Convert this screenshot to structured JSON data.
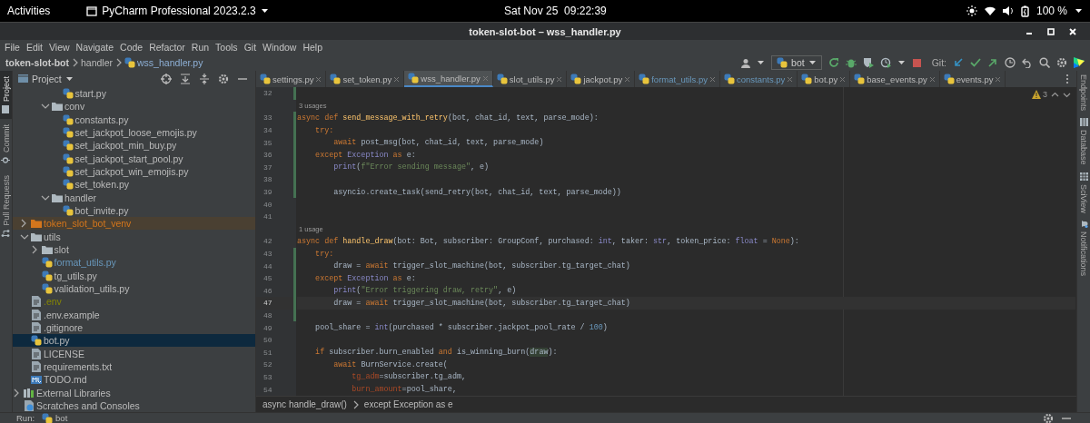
{
  "top_bar": {
    "activities": "Activities",
    "app_menu": "PyCharm Professional 2023.2.3",
    "clock": "Sat Nov 25  09:22:39",
    "battery": "100 %"
  },
  "window": {
    "title": "token-slot-bot – wss_handler.py"
  },
  "menu": [
    "File",
    "Edit",
    "View",
    "Navigate",
    "Code",
    "Refactor",
    "Run",
    "Tools",
    "Git",
    "Window",
    "Help"
  ],
  "breadcrumb": [
    {
      "label": "token-slot-bot",
      "kind": "project"
    },
    {
      "label": "handler",
      "kind": "folder"
    },
    {
      "label": "wss_handler.py",
      "kind": "file"
    }
  ],
  "toolbar": {
    "run_config": "bot",
    "git_label": "Git:"
  },
  "left_strip": [
    {
      "label": "Project",
      "selected": true
    },
    {
      "label": "Commit",
      "selected": false
    },
    {
      "label": "Pull Requests",
      "selected": false
    }
  ],
  "project_panel": {
    "title": "Project",
    "tree": [
      {
        "children": [
          {
            "children": [
              {
                "children": [
                  {
                    "children": [
                      {
                        "label": "start.py",
                        "kind": "python",
                        "selected": false
                      }
                    ]
                  },
                  {
                    "label": "conv",
                    "kind": "folder",
                    "expanded": true,
                    "selected": false,
                    "excluded": false,
                    "children": [
                      {
                        "label": "constants.py",
                        "kind": "python",
                        "selected": false
                      },
                      {
                        "label": "set_jackpot_loose_emojis.py",
                        "kind": "python",
                        "selected": false
                      },
                      {
                        "label": "set_jackpot_min_buy.py",
                        "kind": "python",
                        "selected": false
                      },
                      {
                        "label": "set_jackpot_start_pool.py",
                        "kind": "python",
                        "selected": false
                      },
                      {
                        "label": "set_jackpot_win_emojis.py",
                        "kind": "python",
                        "selected": false
                      },
                      {
                        "label": "set_token.py",
                        "kind": "python",
                        "selected": false
                      }
                    ]
                  },
                  {
                    "label": "handler",
                    "kind": "folder",
                    "expanded": true,
                    "selected": false,
                    "excluded": false,
                    "children": [
                      {
                        "label": "bot_invite.py",
                        "kind": "python",
                        "selected": false
                      }
                    ]
                  }
                ]
              }
            ]
          },
          {
            "label": "token_slot_bot_venv",
            "kind": "folder",
            "expanded": false,
            "selected": false,
            "excluded": true,
            "color": "#d4761c"
          },
          {
            "label": "utils",
            "kind": "folder",
            "expanded": true,
            "selected": false,
            "excluded": false,
            "children": [
              {
                "label": "slot",
                "kind": "folder",
                "expanded": false,
                "selected": false,
                "excluded": false
              },
              {
                "label": "format_utils.py",
                "kind": "python",
                "selected": false,
                "color": "#6897bb"
              },
              {
                "label": "tg_utils.py",
                "kind": "python",
                "selected": false
              },
              {
                "label": "validation_utils.py",
                "kind": "python",
                "selected": false
              }
            ]
          },
          {
            "label": ".env",
            "kind": "text",
            "selected": false,
            "color": "#848504"
          },
          {
            "label": ".env.example",
            "kind": "text",
            "selected": false
          },
          {
            "label": ".gitignore",
            "kind": "text",
            "selected": false
          },
          {
            "label": "bot.py",
            "kind": "python",
            "selected": true
          },
          {
            "label": "LICENSE",
            "kind": "text",
            "selected": false
          },
          {
            "label": "requirements.txt",
            "kind": "text",
            "selected": false
          },
          {
            "label": "TODO.md",
            "kind": "markdown",
            "selected": false
          }
        ]
      },
      {
        "label": "External Libraries",
        "kind": "library",
        "expanded": false,
        "selected": false
      },
      {
        "label": "Scratches and Consoles",
        "kind": "scratches",
        "selected": false
      }
    ]
  },
  "editor_tabs": [
    {
      "label": "settings.py",
      "selected": false,
      "modified": false
    },
    {
      "label": "set_token.py",
      "selected": false,
      "modified": false
    },
    {
      "label": "wss_handler.py",
      "selected": true,
      "modified": false
    },
    {
      "label": "slot_utils.py",
      "selected": false,
      "modified": false
    },
    {
      "label": "jackpot.py",
      "selected": false,
      "modified": false
    },
    {
      "label": "format_utils.py",
      "selected": false,
      "modified": true
    },
    {
      "label": "constants.py",
      "selected": false,
      "modified": true
    },
    {
      "label": "bot.py",
      "selected": false,
      "modified": false
    },
    {
      "label": "base_events.py",
      "selected": false,
      "modified": false
    },
    {
      "label": "events.py",
      "selected": false,
      "modified": false
    }
  ],
  "editor": {
    "warnings": "3",
    "lines": [
      {
        "kind": "code",
        "number": "32",
        "current": false,
        "changed": true
      },
      {
        "kind": "hint",
        "text": "3 usages"
      },
      {
        "kind": "code",
        "number": "33",
        "current": false,
        "changed": true,
        "tokens": [
          {
            "kind": "kw",
            "text": "async def "
          },
          {
            "kind": "fn",
            "text": "send_message_with_retry"
          },
          {
            "kind": "plain",
            "text": "(bot, chat_id, text, parse_mode):"
          }
        ]
      },
      {
        "kind": "code",
        "number": "34",
        "current": false,
        "changed": true,
        "tokens": [
          {
            "kind": "kw",
            "text": "    try:"
          }
        ]
      },
      {
        "kind": "code",
        "number": "35",
        "current": false,
        "changed": true,
        "tokens": [
          {
            "kind": "kw",
            "text": "        await "
          },
          {
            "kind": "plain",
            "text": "post_msg(bot, chat_id, text, parse_mode)"
          }
        ]
      },
      {
        "kind": "code",
        "number": "36",
        "current": false,
        "changed": true,
        "tokens": [
          {
            "kind": "kw",
            "text": "    except "
          },
          {
            "kind": "builtin",
            "text": "Exception"
          },
          {
            "kind": "kw",
            "text": " as "
          },
          {
            "kind": "plain",
            "text": "e:"
          }
        ]
      },
      {
        "kind": "code",
        "number": "37",
        "current": false,
        "changed": true,
        "tokens": [
          {
            "kind": "builtin",
            "text": "        print"
          },
          {
            "kind": "plain",
            "text": "("
          },
          {
            "kind": "str",
            "text": "f\"Error sending message\""
          },
          {
            "kind": "plain",
            "text": ", e)"
          }
        ]
      },
      {
        "kind": "code",
        "number": "38",
        "current": false,
        "changed": true
      },
      {
        "kind": "code",
        "number": "39",
        "current": false,
        "changed": true,
        "tokens": [
          {
            "kind": "plain",
            "text": "        asyncio.create_task(send_retry(bot, chat_id, text, parse_mode))"
          }
        ]
      },
      {
        "kind": "code",
        "number": "40",
        "current": false,
        "changed": false
      },
      {
        "kind": "code",
        "number": "41",
        "current": false,
        "changed": false
      },
      {
        "kind": "hint",
        "text": "1 usage"
      },
      {
        "kind": "code",
        "number": "42",
        "current": false,
        "changed": false,
        "tokens": [
          {
            "kind": "kw",
            "text": "async def "
          },
          {
            "kind": "fn",
            "text": "handle_draw"
          },
          {
            "kind": "plain",
            "text": "(bot: Bot, subscriber: GroupConf, purchased: "
          },
          {
            "kind": "builtin",
            "text": "int"
          },
          {
            "kind": "plain",
            "text": ", taker: "
          },
          {
            "kind": "builtin",
            "text": "str"
          },
          {
            "kind": "plain",
            "text": ", token_price: "
          },
          {
            "kind": "builtin",
            "text": "float"
          },
          {
            "kind": "plain",
            "text": " = "
          },
          {
            "kind": "kw",
            "text": "None"
          },
          {
            "kind": "plain",
            "text": "):"
          }
        ]
      },
      {
        "kind": "code",
        "number": "43",
        "current": false,
        "changed": true,
        "tokens": [
          {
            "kind": "kw",
            "text": "    try:"
          }
        ]
      },
      {
        "kind": "code",
        "number": "44",
        "current": false,
        "changed": true,
        "tokens": [
          {
            "kind": "plain",
            "text": "        draw = "
          },
          {
            "kind": "kw",
            "text": "await "
          },
          {
            "kind": "plain",
            "text": "trigger_slot_machine(bot, subscriber.tg_target_chat)"
          }
        ]
      },
      {
        "kind": "code",
        "number": "45",
        "current": false,
        "changed": true,
        "tokens": [
          {
            "kind": "kw",
            "text": "    except "
          },
          {
            "kind": "builtin",
            "text": "Exception"
          },
          {
            "kind": "kw",
            "text": " as "
          },
          {
            "kind": "plain",
            "text": "e:"
          }
        ]
      },
      {
        "kind": "code",
        "number": "46",
        "current": false,
        "changed": true,
        "tokens": [
          {
            "kind": "builtin",
            "text": "        print"
          },
          {
            "kind": "plain",
            "text": "("
          },
          {
            "kind": "str",
            "text": "\"Error triggering draw, retry\""
          },
          {
            "kind": "plain",
            "text": ", e)"
          }
        ]
      },
      {
        "kind": "code",
        "number": "47",
        "current": true,
        "changed": true,
        "tokens": [
          {
            "kind": "plain",
            "text": "        draw = "
          },
          {
            "kind": "kw",
            "text": "await "
          },
          {
            "kind": "plain",
            "text": "trigger_slot_machine(bot, subscriber.tg_target_chat)"
          }
        ]
      },
      {
        "kind": "code",
        "number": "48",
        "current": false,
        "changed": true
      },
      {
        "kind": "code",
        "number": "49",
        "current": false,
        "changed": false,
        "tokens": [
          {
            "kind": "plain",
            "text": "    pool_share = "
          },
          {
            "kind": "builtin",
            "text": "int"
          },
          {
            "kind": "plain",
            "text": "(purchased * subscriber.jackpot_pool_rate / "
          },
          {
            "kind": "num",
            "text": "100"
          },
          {
            "kind": "plain",
            "text": ")"
          }
        ]
      },
      {
        "kind": "code",
        "number": "50",
        "current": false,
        "changed": false
      },
      {
        "kind": "code",
        "number": "51",
        "current": false,
        "changed": false,
        "tokens": [
          {
            "kind": "kw",
            "text": "    if "
          },
          {
            "kind": "plain",
            "text": "subscriber.burn_enabled "
          },
          {
            "kind": "kw",
            "text": "and "
          },
          {
            "kind": "plain",
            "text": "is_winning_burn("
          },
          {
            "kind": "ref",
            "text": "draw"
          },
          {
            "kind": "plain",
            "text": "):"
          }
        ]
      },
      {
        "kind": "code",
        "number": "52",
        "current": false,
        "changed": false,
        "tokens": [
          {
            "kind": "kw",
            "text": "        await "
          },
          {
            "kind": "plain",
            "text": "BurnService.create("
          }
        ]
      },
      {
        "kind": "code",
        "number": "53",
        "current": false,
        "changed": false,
        "tokens": [
          {
            "kind": "param",
            "text": "            tg_adm"
          },
          {
            "kind": "plain",
            "text": "=subscriber.tg_adm,"
          }
        ]
      },
      {
        "kind": "code",
        "number": "54",
        "current": false,
        "changed": false,
        "tokens": [
          {
            "kind": "param",
            "text": "            burn_amount"
          },
          {
            "kind": "plain",
            "text": "=pool_share,"
          }
        ]
      }
    ],
    "breadcrumb": [
      "async handle_draw()",
      "except Exception as e"
    ]
  },
  "right_strip": [
    "Endpoints",
    "Database",
    "SciView",
    "Notifications"
  ],
  "run_bar": {
    "label": "Run:",
    "config": "bot"
  }
}
